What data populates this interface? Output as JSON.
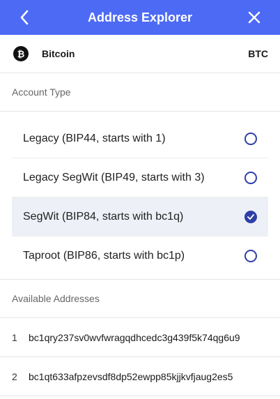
{
  "header": {
    "title": "Address Explorer"
  },
  "coin": {
    "icon_glyph": "₿",
    "name": "Bitcoin",
    "ticker": "BTC"
  },
  "account_type": {
    "label": "Account Type",
    "options": [
      {
        "label": "Legacy (BIP44, starts with 1)",
        "selected": false
      },
      {
        "label": "Legacy SegWit (BIP49, starts with 3)",
        "selected": false
      },
      {
        "label": "SegWit (BIP84, starts with bc1q)",
        "selected": true
      },
      {
        "label": "Taproot (BIP86, starts with bc1p)",
        "selected": false
      }
    ]
  },
  "addresses": {
    "label": "Available Addresses",
    "items": [
      {
        "index": "1",
        "address": "bc1qry237sv0wvfwragqdhcedc3g439f5k74qg6u9"
      },
      {
        "index": "2",
        "address": "bc1qt633afpzevsdf8dp52ewpp85kjjkvfjaug2es5"
      }
    ]
  },
  "colors": {
    "header": "#4d6af5",
    "accent": "#2e3fa8",
    "selected_bg": "#eef0f7"
  }
}
